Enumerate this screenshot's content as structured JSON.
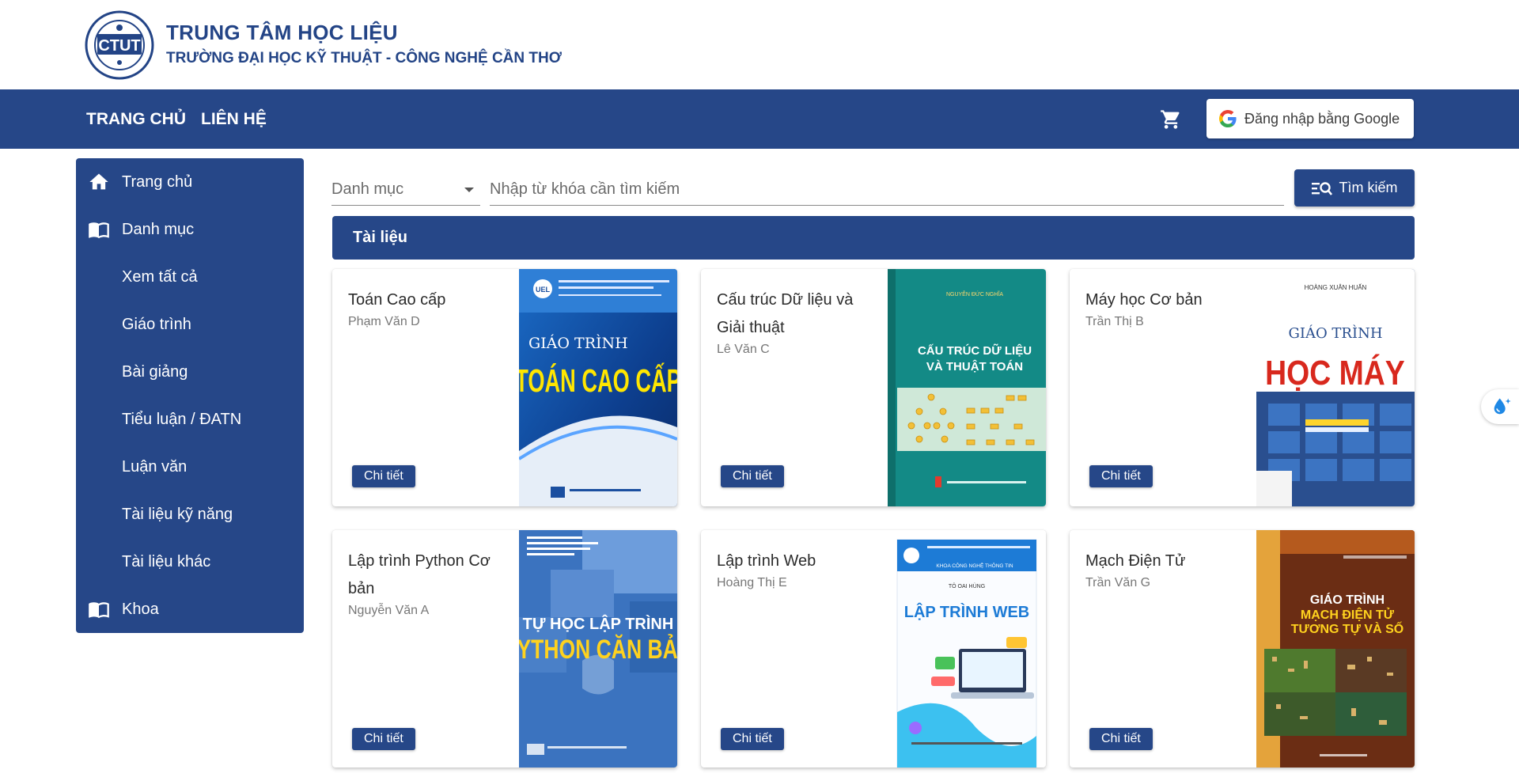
{
  "header": {
    "title": "TRUNG TÂM HỌC LIỆU",
    "subtitle": "TRƯỜNG ĐẠI HỌC KỸ THUẬT - CÔNG NGHỆ CẦN THƠ",
    "logo_text": "CTUT"
  },
  "nav": {
    "home": "TRANG CHỦ",
    "contact": "LIÊN HỆ",
    "login_label": "Đăng nhập bằng Google"
  },
  "sidebar": {
    "items": [
      {
        "label": "Trang chủ",
        "icon": "home-icon"
      },
      {
        "label": "Danh mục",
        "icon": "book-icon"
      },
      {
        "label": "Xem tất cả"
      },
      {
        "label": "Giáo trình"
      },
      {
        "label": "Bài giảng"
      },
      {
        "label": "Tiểu luận / ĐATN"
      },
      {
        "label": "Luận văn"
      },
      {
        "label": "Tài liệu kỹ năng"
      },
      {
        "label": "Tài liệu khác"
      },
      {
        "label": "Khoa",
        "icon": "book-icon"
      }
    ]
  },
  "search": {
    "category_label": "Danh mục",
    "placeholder": "Nhập từ khóa cần tìm kiếm",
    "button_label": "Tìm kiếm"
  },
  "section": {
    "title": "Tài liệu"
  },
  "cards": [
    {
      "title": "Toán Cao cấp",
      "author": "Phạm Văn D",
      "button": "Chi tiết",
      "cover": {
        "line1": "GIÁO TRÌNH",
        "line2": "TOÁN CAO CẤP",
        "top": "UEL"
      }
    },
    {
      "title": "Cấu trúc Dữ liệu và Giải thuật",
      "author": "Lê Văn C",
      "button": "Chi tiết",
      "cover": {
        "line1": "CẤU TRÚC DỮ LIỆU",
        "line2": "VÀ THUẬT TOÁN",
        "top": "NGUYỄN ĐỨC NGHĨA"
      }
    },
    {
      "title": "Máy học Cơ bản",
      "author": "Trần Thị B",
      "button": "Chi tiết",
      "cover": {
        "line1": "GIÁO TRÌNH",
        "line2": "HỌC MÁY",
        "top": "HOÀNG XUÂN HUẤN"
      }
    },
    {
      "title": "Lập trình Python Cơ bản",
      "author": "Nguyễn Văn A",
      "button": "Chi tiết",
      "cover": {
        "line1": "TỰ HỌC LẬP TRÌNH",
        "line2": "PYTHON CĂN BẢN"
      }
    },
    {
      "title": "Lập trình Web",
      "author": "Hoàng Thị E",
      "button": "Chi tiết",
      "cover": {
        "line1": "LẬP TRÌNH WEB",
        "top": "KHOA CÔNG NGHỆ THÔNG TIN",
        "author": "TÔ OAI HÙNG"
      }
    },
    {
      "title": "Mạch Điện Tử",
      "author": "Trần Văn G",
      "button": "Chi tiết",
      "cover": {
        "line1": "GIÁO TRÌNH",
        "line2": "MẠCH ĐIỆN TỬ",
        "line3": "TƯƠNG TỰ VÀ SỐ"
      }
    }
  ],
  "colors": {
    "primary": "#264788",
    "title_text": "#234486"
  }
}
